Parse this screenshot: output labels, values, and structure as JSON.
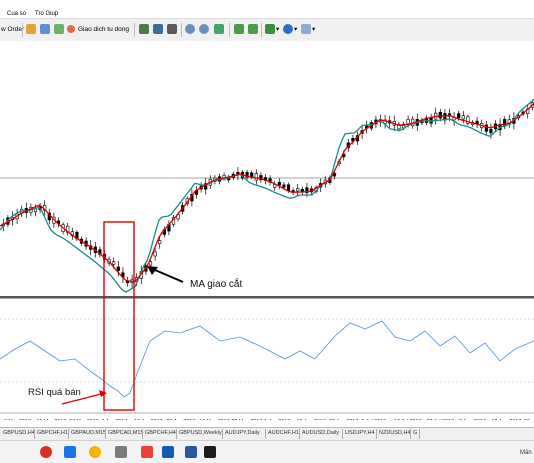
{
  "menu": {
    "items": [
      "Cua so",
      "Tro Giup"
    ]
  },
  "toolbar": {
    "new_order_label": "w Order",
    "autotrade_label": "Giao dich tu dong"
  },
  "chart": {
    "date_labels": [
      "3 Mar 2017",
      "15 Mar 2017",
      "27 Mar 2017",
      "6 Apr 2017",
      "18 Apr 2017",
      "28 Apr 2017",
      "10 May 2017",
      "22 May 2017",
      "1 Jun 2017",
      "13 Jun 2017",
      "23 Jun 2017",
      "5 Jul 2017",
      "17 Jul 2017",
      "27 Jul 2017",
      "8 Aug 2017",
      "18 Aug 2017",
      "30"
    ],
    "annotation_ma": "MA giao cắt",
    "annotation_rsi": "RSI quá bán",
    "colors": {
      "candle": "#000000",
      "ma_fast": "#e00000",
      "ma_slow": "#1a8c8c",
      "rsi_line": "#4a90e2",
      "highlight_box": "#e60000",
      "arrow_ma": "#000000",
      "arrow_rsi": "#e00000"
    }
  },
  "tabs": [
    "GBPUSD,H4",
    "GBPCHF,H1",
    "GBPAUD,M15",
    "GBPCAD,M15",
    "GBPCHF,H4",
    "GBPUSD,Weekly",
    "AUDJPY,Daily",
    "AUDCHF,H1",
    "AUDUSD,Daily",
    "USDJPY,H4",
    "NZDUSD,H4",
    "G"
  ],
  "taskbar": {
    "items": [
      "record-icon",
      "media-icon",
      "chrome-icon",
      "file-icon",
      "gmail-icon",
      "outlook-icon",
      "word-icon",
      "metatrader-icon"
    ],
    "right_label": "Măn"
  }
}
